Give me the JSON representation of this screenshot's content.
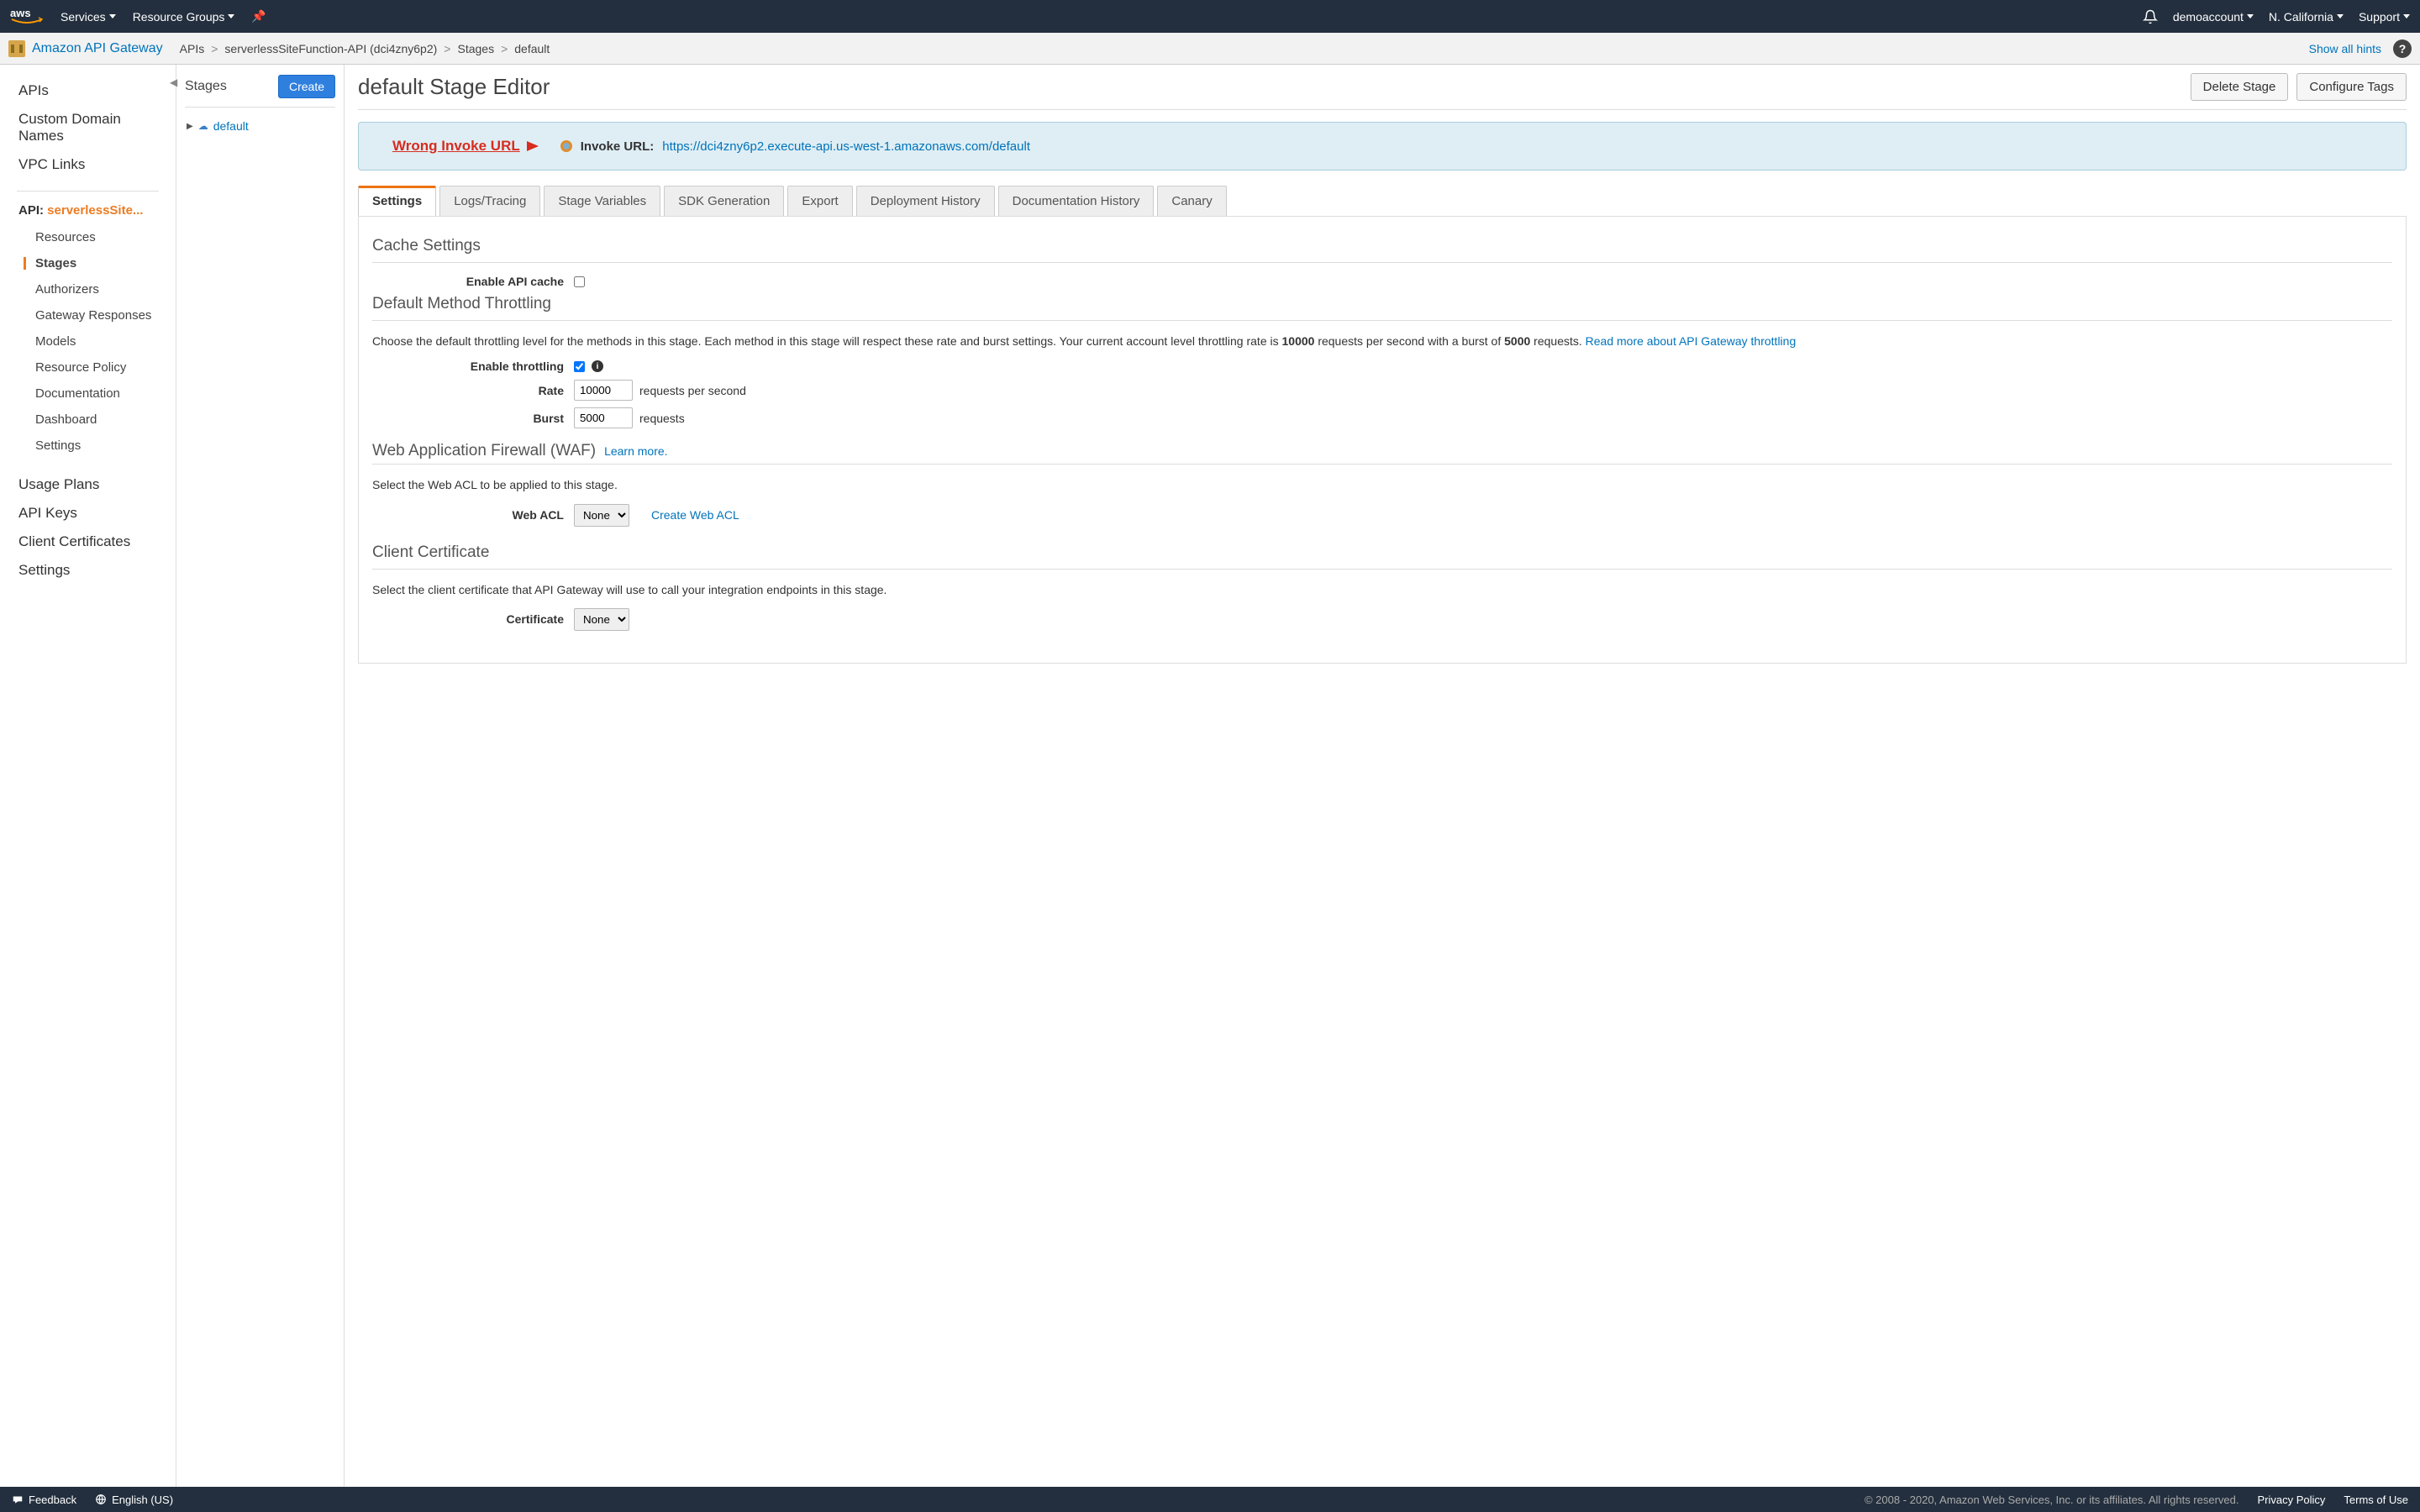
{
  "topnav": {
    "services": "Services",
    "resource_groups": "Resource Groups",
    "account": "demoaccount",
    "region": "N. California",
    "support": "Support"
  },
  "subnav": {
    "service_name": "Amazon API Gateway",
    "breadcrumb": [
      "APIs",
      "serverlessSiteFunction-API (dci4zny6p2)",
      "Stages",
      "default"
    ],
    "hints": "Show all hints"
  },
  "left": {
    "primary": [
      "APIs",
      "Custom Domain Names",
      "VPC Links"
    ],
    "api_label_prefix": "API: ",
    "api_name": "serverlessSite...",
    "api_items": [
      "Resources",
      "Stages",
      "Authorizers",
      "Gateway Responses",
      "Models",
      "Resource Policy",
      "Documentation",
      "Dashboard",
      "Settings"
    ],
    "active_api_item": "Stages",
    "lower": [
      "Usage Plans",
      "API Keys",
      "Client Certificates",
      "Settings"
    ]
  },
  "mid": {
    "title": "Stages",
    "create_btn": "Create",
    "stage_name": "default"
  },
  "main": {
    "title": "default Stage Editor",
    "actions": {
      "delete": "Delete Stage",
      "configure_tags": "Configure Tags"
    },
    "annotation": "Wrong Invoke URL",
    "invoke_label": "Invoke URL:",
    "invoke_url": "https://dci4zny6p2.execute-api.us-west-1.amazonaws.com/default",
    "tabs": [
      "Settings",
      "Logs/Tracing",
      "Stage Variables",
      "SDK Generation",
      "Export",
      "Deployment History",
      "Documentation History",
      "Canary"
    ],
    "active_tab": "Settings",
    "cache": {
      "title": "Cache Settings",
      "enable_label": "Enable API cache",
      "enabled": false
    },
    "throttling": {
      "title": "Default Method Throttling",
      "desc_pre": "Choose the default throttling level for the methods in this stage. Each method in this stage will respect these rate and burst settings. Your current account level throttling rate is ",
      "rate_bold": "10000",
      "desc_mid": " requests per second with a burst of ",
      "burst_bold": "5000",
      "desc_post": " requests. ",
      "read_more": "Read more about API Gateway throttling",
      "enable_label": "Enable throttling",
      "enabled": true,
      "rate_label": "Rate",
      "rate_value": "10000",
      "rate_unit": "requests per second",
      "burst_label": "Burst",
      "burst_value": "5000",
      "burst_unit": "requests"
    },
    "waf": {
      "title": "Web Application Firewall (WAF)",
      "learn_more": "Learn more.",
      "desc": "Select the Web ACL to be applied to this stage.",
      "acl_label": "Web ACL",
      "acl_value": "None",
      "create_acl": "Create Web ACL"
    },
    "client_cert": {
      "title": "Client Certificate",
      "desc": "Select the client certificate that API Gateway will use to call your integration endpoints in this stage.",
      "cert_label": "Certificate",
      "cert_value": "None"
    }
  },
  "footer": {
    "feedback": "Feedback",
    "language": "English (US)",
    "copyright": "© 2008 - 2020, Amazon Web Services, Inc. or its affiliates. All rights reserved.",
    "privacy": "Privacy Policy",
    "terms": "Terms of Use"
  }
}
